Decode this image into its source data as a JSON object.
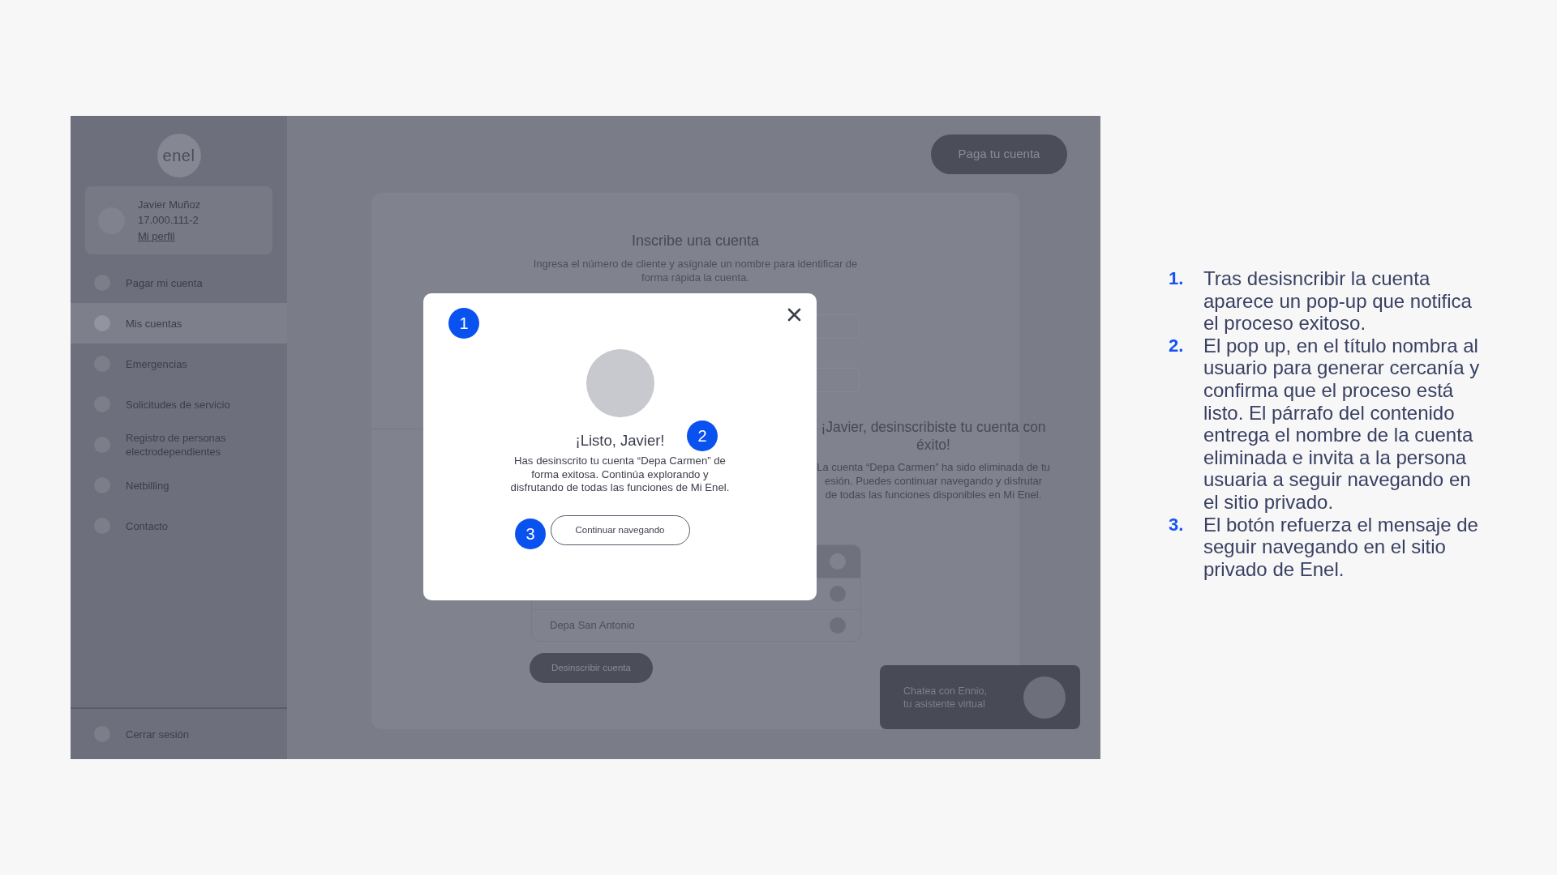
{
  "sidebar": {
    "logo": "enel",
    "profile": {
      "name": "Javier Muñoz",
      "id": "17.000.111-2",
      "link": "Mi perfil"
    },
    "items": [
      {
        "label": "Pagar mi cuenta",
        "selected": false
      },
      {
        "label": "Mis cuentas",
        "selected": true
      },
      {
        "label": "Emergencias",
        "selected": false
      },
      {
        "label": "Solicitudes de servicio",
        "selected": false
      },
      {
        "label": "Registro de personas electrodependientes",
        "selected": false
      },
      {
        "label": "Netbilling",
        "selected": false
      },
      {
        "label": "Contacto",
        "selected": false
      }
    ],
    "logout": "Cerrar sesión"
  },
  "header": {
    "pay_button": "Paga tu cuenta"
  },
  "form": {
    "title": "Inscribe una cuenta",
    "subtitle": "Ingresa el número de cliente y asígnale un nombre para identificar de forma rápida la cuenta."
  },
  "success_message": {
    "title": "¡Javier, desinscribiste tu cuenta con éxito!",
    "lines": [
      "La cuenta “Depa Carmen” ha sido eliminada de tu",
      "esión. Puedes continuar navegando y disfrutar",
      "de todas las funciones disponibles en Mi Enel."
    ]
  },
  "accounts": [
    {
      "kind": "header"
    },
    {
      "kind": "row"
    },
    {
      "kind": "row",
      "name": "Depa San Antonio"
    }
  ],
  "unsubscribe_button": "Desinscribir cuenta",
  "chat": {
    "lines": [
      "Chatea con Ennio,",
      "tu asistente virtual"
    ]
  },
  "modal": {
    "title": "¡Listo, Javier!",
    "body": "Has desinscrito tu cuenta “Depa Carmen” de forma exitosa. Continúa explorando y disfrutando de todas las funciones de Mi Enel.",
    "button": "Continuar navegando"
  },
  "markers": [
    "1",
    "2",
    "3"
  ],
  "notes": [
    {
      "number": "1.",
      "text": "Tras desisncribir la cuenta aparece un pop-up que notifica el proceso exitoso."
    },
    {
      "number": "2.",
      "text": "El pop up, en el título nombra al usuario para generar cercanía y confirma que el proceso está listo. El párrafo del contenido entrega el nombre de la cuenta eliminada e invita a la persona usuaria a seguir navegando en el sitio privado."
    },
    {
      "number": "3.",
      "text": "El botón refuerza el mensaje de seguir navegando en el sitio privado de Enel."
    }
  ]
}
